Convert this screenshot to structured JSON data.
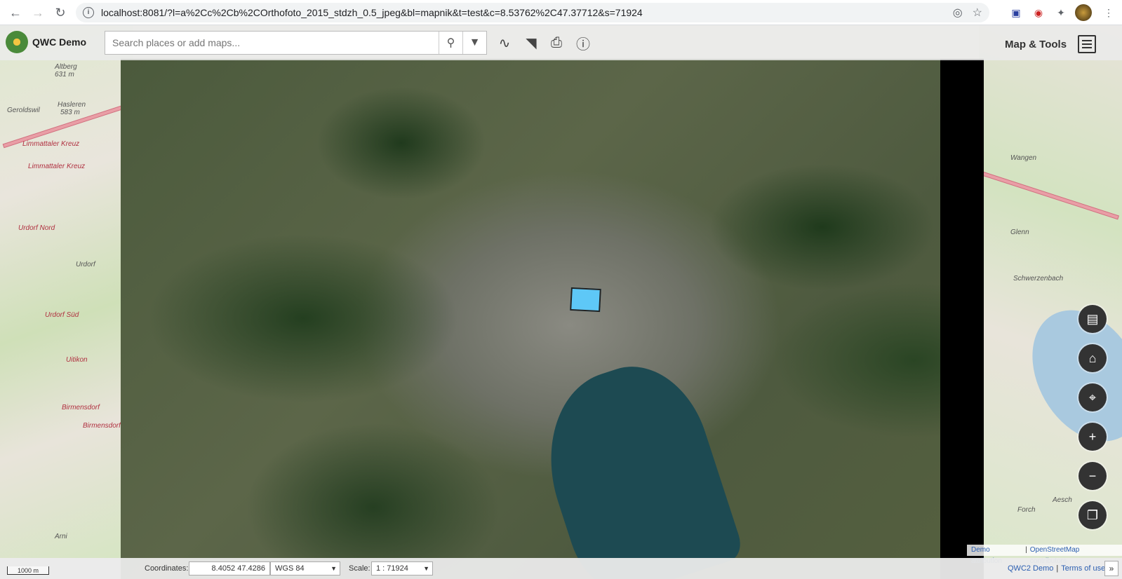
{
  "browser": {
    "url": "localhost:8081/?l=a%2Cc%2Cb%2COrthofoto_2015_stdzh_0.5_jpeg&bl=mapnik&t=test&c=8.53762%2C47.37712&s=71924"
  },
  "app": {
    "title": "QWC Demo",
    "search_placeholder": "Search places or add maps...",
    "map_tools_label": "Map & Tools"
  },
  "map_labels": {
    "left": [
      "Altberg",
      "631 m",
      "Geroldswil",
      "Hasleren",
      "583 m",
      "Limmattaler Kreuz",
      "Limmattaler Kreuz",
      "Urdorf Nord",
      "Urdorf",
      "Urdorf Süd",
      "Uitikon",
      "Birmensdorf",
      "Birmensdorf",
      "Arni"
    ],
    "right": [
      "Wangen",
      "Glenn",
      "Schwerzenbach",
      "Aesch",
      "Forch"
    ]
  },
  "bottombar": {
    "scale_bar": "1000 m",
    "coordinates_label": "Coordinates:",
    "coordinates_value": "8.4052 47.4286",
    "crs": "WGS 84",
    "scale_label": "Scale:",
    "scale_value": "1 : 71924",
    "demo_attribution": "Demo attribution",
    "osm_attribution": "OpenStreetMap contributors",
    "qwc_link": "QWC2 Demo",
    "terms_link": "Terms of use"
  },
  "icons": {
    "logo": "qwc-logo-icon",
    "search": "search-icon",
    "filter": "filter-icon",
    "measure": "measure-icon",
    "redlining": "redlining-icon",
    "print": "print-icon",
    "identify": "identify-icon",
    "menu": "hamburger-menu-icon",
    "legend": "legend-icon",
    "home": "home-icon",
    "locate": "locate-icon",
    "zoom_in": "zoom-in-icon",
    "zoom_out": "zoom-out-icon",
    "background": "background-switcher-icon"
  },
  "colors": {
    "highlight": "#5ec8f7",
    "link": "#2a5db0"
  }
}
